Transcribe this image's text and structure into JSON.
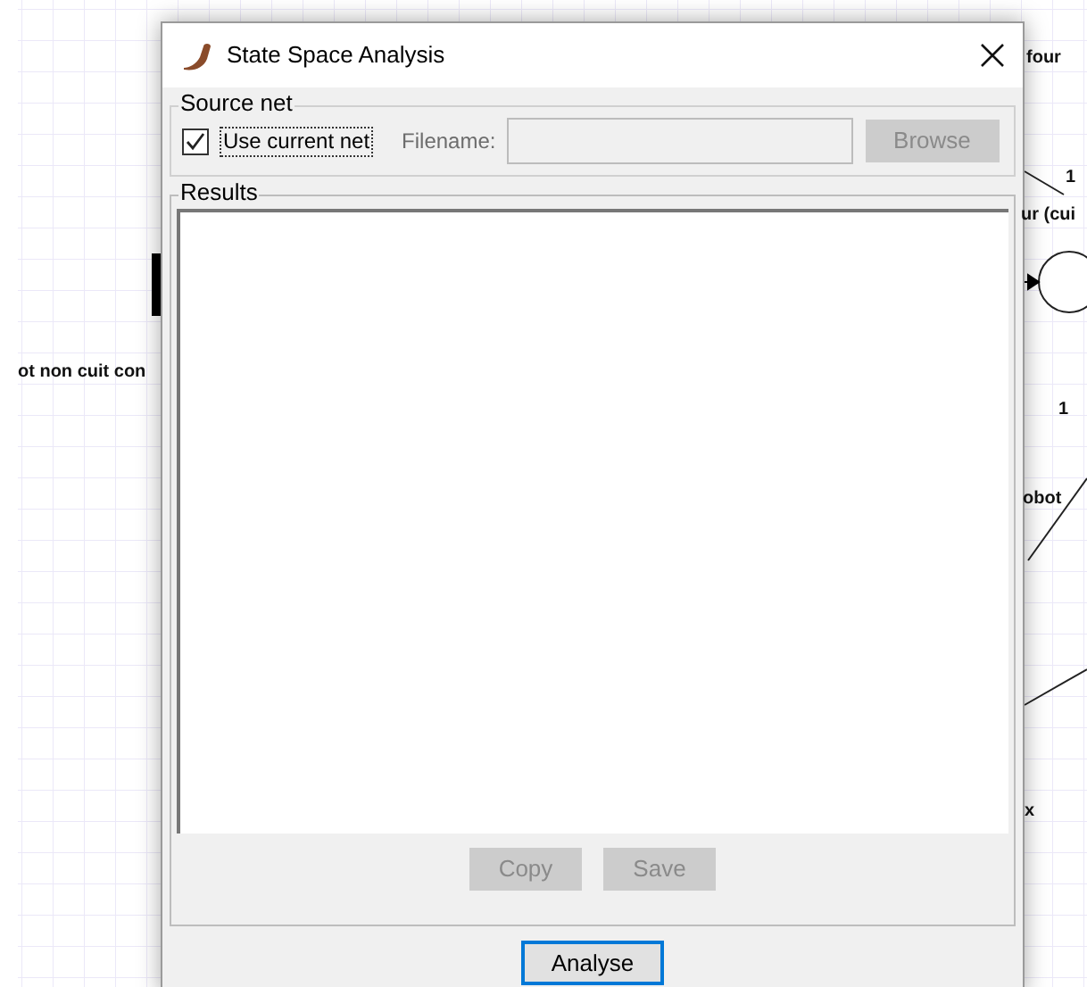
{
  "canvas": {
    "labels": [
      {
        "text": "four"
      },
      {
        "text": "1"
      },
      {
        "text": "ur (cui"
      },
      {
        "text": "ot non cuit con"
      },
      {
        "text": "1"
      },
      {
        "text": "obot"
      },
      {
        "text": "x"
      }
    ]
  },
  "dialog": {
    "title": "State Space Analysis",
    "source_net": {
      "legend": "Source net",
      "use_current": {
        "label": "Use current net",
        "checked": true
      },
      "filename_label": "Filename:",
      "browse": {
        "label": "Browse",
        "disabled": true
      }
    },
    "results": {
      "legend": "Results",
      "copy": {
        "label": "Copy",
        "disabled": true
      },
      "save": {
        "label": "Save",
        "disabled": true
      }
    },
    "analyse": {
      "label": "Analyse",
      "focused": true
    }
  }
}
